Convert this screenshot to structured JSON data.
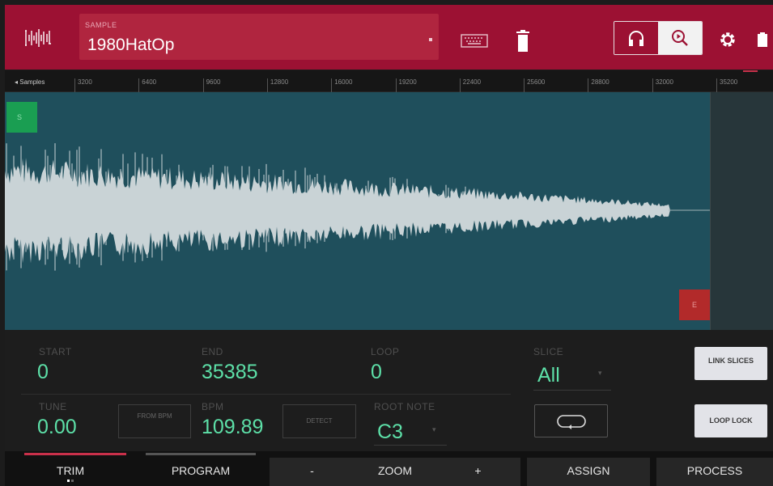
{
  "header": {
    "sample_caption": "SAMPLE",
    "sample_name": "1980HatOp",
    "accent_color": "#9c1133"
  },
  "icons": {
    "mode": "waveform-editor-icon",
    "keyboard": "keyboard-icon",
    "trash": "trash-icon",
    "headphones": "headphones-icon",
    "zoom_play": "zoom-play-icon",
    "gear": "gear-icon",
    "battery": "battery-icon"
  },
  "ruler": {
    "label": "Samples",
    "ticks": [
      "3200",
      "6400",
      "9600",
      "12800",
      "16000",
      "19200",
      "22400",
      "25600",
      "28800",
      "32000",
      "35200"
    ]
  },
  "markers": {
    "start": "S",
    "end": "E"
  },
  "params": {
    "start": {
      "label": "START",
      "value": "0"
    },
    "end": {
      "label": "END",
      "value": "35385"
    },
    "loop": {
      "label": "LOOP",
      "value": "0"
    },
    "slice": {
      "label": "SLICE",
      "value": "All"
    },
    "tune": {
      "label": "TUNE",
      "value": "0.00"
    },
    "from_bpm": "FROM BPM",
    "bpm": {
      "label": "BPM",
      "value": "109.89"
    },
    "detect": "DETECT",
    "root_note": {
      "label": "ROOT NOTE",
      "value": "C3"
    },
    "link_slices": "LINK SLICES",
    "loop_lock": "LOOP LOCK"
  },
  "bottom": {
    "trim": "TRIM",
    "program": "PROGRAM",
    "zoom_minus": "-",
    "zoom": "ZOOM",
    "zoom_plus": "+",
    "assign": "ASSIGN",
    "process": "PROCESS"
  }
}
